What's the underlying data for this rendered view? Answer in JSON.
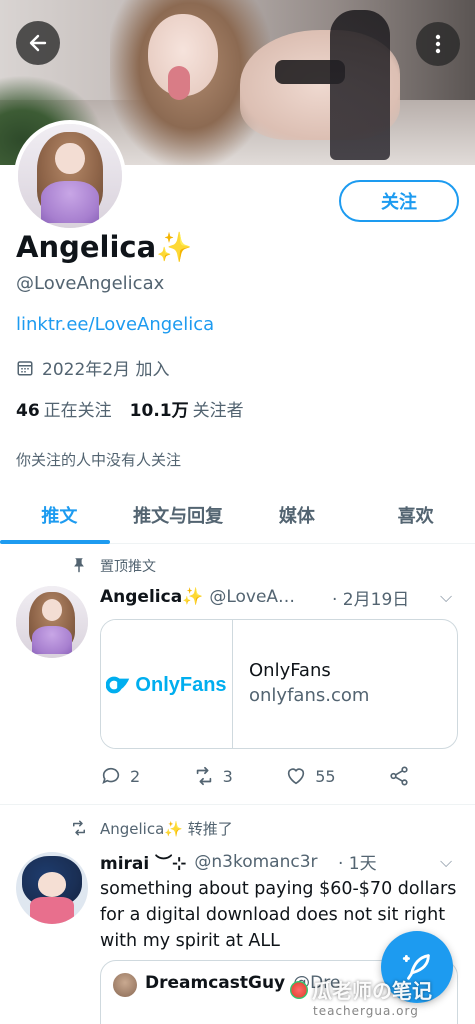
{
  "header": {
    "back_icon": "back-arrow-icon",
    "more_icon": "more-vertical-icon"
  },
  "profile": {
    "name": "Angelica",
    "name_emoji": "✨",
    "handle": "@LoveAngelicax",
    "link": "linktr.ee/LoveAngelica",
    "joined": "2022年2月 加入",
    "following_count": "46",
    "following_label": "正在关注",
    "followers_count": "10.1万",
    "followers_label": "关注者",
    "followers_note": "你关注的人中没有人关注",
    "follow_button": "关注"
  },
  "tabs": [
    {
      "label": "推文",
      "active": true
    },
    {
      "label": "推文与回复",
      "active": false
    },
    {
      "label": "媒体",
      "active": false
    },
    {
      "label": "喜欢",
      "active": false
    }
  ],
  "pinned_tweet": {
    "pinned_label": "置顶推文",
    "author_name": "Angelica✨",
    "author_handle": "@LoveA…",
    "date": "· 2月19日",
    "card": {
      "logo_text": "OnlyFans",
      "title": "OnlyFans",
      "domain": "onlyfans.com"
    },
    "replies": "2",
    "retweets": "3",
    "likes": "55"
  },
  "retweet": {
    "label": "Angelica✨ 转推了",
    "author_name": "mirai ︶⊹",
    "author_handle": "@n3komanc3r",
    "date": "· 1天",
    "text": "something about paying $60-$70 dollars for a digital download does not sit right with my spirit at ALL",
    "quote_name": "DreamcastGuy",
    "quote_handle": "@Dre"
  },
  "watermark": {
    "text": "瓜老师の笔记",
    "sub": "teachergua.org"
  },
  "colors": {
    "accent": "#1d9bf0",
    "text_primary": "#0f1419",
    "text_secondary": "#536471",
    "onlyfans_blue": "#00aeef"
  }
}
